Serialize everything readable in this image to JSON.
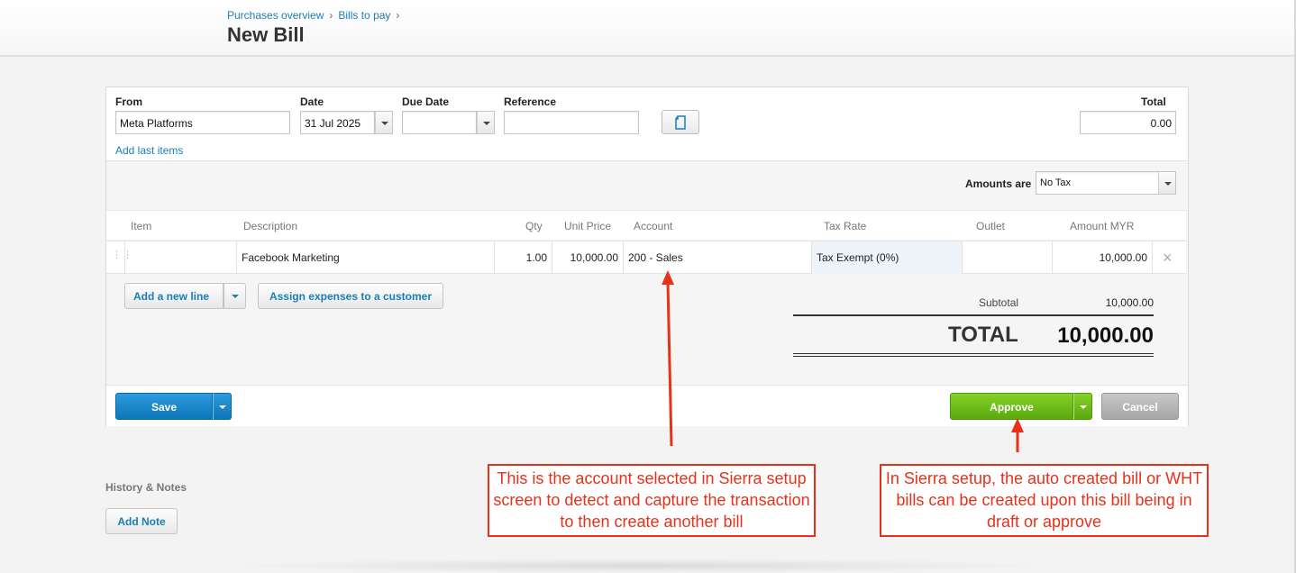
{
  "breadcrumb": {
    "item1": "Purchases overview",
    "item2": "Bills to pay",
    "sep": "›"
  },
  "page_title": "New Bill",
  "form": {
    "from_label": "From",
    "from_value": "Meta Platforms",
    "date_label": "Date",
    "date_value": "31 Jul 2025",
    "due_label": "Due Date",
    "due_value": "",
    "ref_label": "Reference",
    "ref_value": "",
    "total_label": "Total",
    "total_value": "0.00",
    "add_last_items": "Add last items",
    "amounts_are_label": "Amounts are",
    "amounts_are_value": "No Tax"
  },
  "table": {
    "headers": [
      "Item",
      "Description",
      "Qty",
      "Unit Price",
      "Account",
      "Tax Rate",
      "Outlet",
      "Amount MYR"
    ],
    "rows": [
      {
        "item": "",
        "description": "Facebook Marketing",
        "qty": "1.00",
        "unit_price": "10,000.00",
        "account": "200 - Sales",
        "tax_rate": "Tax Exempt (0%)",
        "outlet": "",
        "amount": "10,000.00"
      }
    ]
  },
  "actions": {
    "add_line": "Add a new line",
    "assign": "Assign expenses to a customer"
  },
  "totals": {
    "subtotal_label": "Subtotal",
    "subtotal_value": "10,000.00",
    "total_label": "TOTAL",
    "total_value": "10,000.00"
  },
  "footer": {
    "save": "Save",
    "approve": "Approve",
    "cancel": "Cancel"
  },
  "history": {
    "title": "History & Notes",
    "add_note": "Add Note"
  },
  "annotations": {
    "left": "This is the account selected in Sierra setup screen to detect and capture the transaction to then create another bill",
    "right": "In Sierra setup, the auto created bill or WHT bills can be created upon this bill being in draft or approve",
    "color": "#e8311a"
  },
  "icons": {
    "reference": "document-icon",
    "remove_row": "close-icon",
    "drag": "drag-handle-icon"
  }
}
